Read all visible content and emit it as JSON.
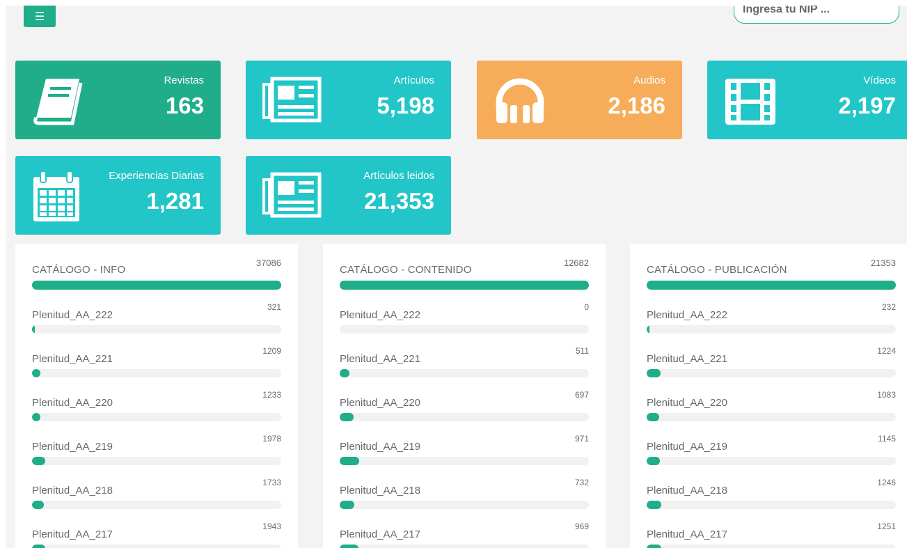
{
  "header": {
    "menu_icon": "menu-icon",
    "search_placeholder": "Ingresa tu NIP ..."
  },
  "colors": {
    "teal": "#23c6c8",
    "green": "#1fad8a",
    "orange": "#f6ac58"
  },
  "stats": [
    {
      "title": "Revistas",
      "value": "163",
      "icon": "magazine-book-icon",
      "color": "green"
    },
    {
      "title": "Artículos",
      "value": "5,198",
      "icon": "newspaper-icon",
      "color": "teal"
    },
    {
      "title": "Audios",
      "value": "2,186",
      "icon": "headphones-icon",
      "color": "orange"
    },
    {
      "title": "Vídeos",
      "value": "2,197",
      "icon": "film-icon",
      "color": "teal"
    },
    {
      "title": "Experiencias Diarias",
      "value": "1,281",
      "icon": "calendar-icon",
      "color": "teal"
    },
    {
      "title": "Artículos leidos",
      "value": "21,353",
      "icon": "newspaper-icon",
      "color": "teal"
    }
  ],
  "panels": [
    {
      "title": "CATÁLOGO - INFO",
      "total": "37086",
      "rows": [
        {
          "label": "Plenitud_AA_222",
          "value": "321",
          "fill": 0.009
        },
        {
          "label": "Plenitud_AA_221",
          "value": "1209",
          "fill": 0.033
        },
        {
          "label": "Plenitud_AA_220",
          "value": "1233",
          "fill": 0.033
        },
        {
          "label": "Plenitud_AA_219",
          "value": "1978",
          "fill": 0.053
        },
        {
          "label": "Plenitud_AA_218",
          "value": "1733",
          "fill": 0.047
        },
        {
          "label": "Plenitud_AA_217",
          "value": "1943",
          "fill": 0.052
        }
      ]
    },
    {
      "title": "CATÁLOGO - CONTENIDO",
      "total": "12682",
      "rows": [
        {
          "label": "Plenitud_AA_222",
          "value": "0",
          "fill": 0
        },
        {
          "label": "Plenitud_AA_221",
          "value": "511",
          "fill": 0.04
        },
        {
          "label": "Plenitud_AA_220",
          "value": "697",
          "fill": 0.055
        },
        {
          "label": "Plenitud_AA_219",
          "value": "971",
          "fill": 0.077
        },
        {
          "label": "Plenitud_AA_218",
          "value": "732",
          "fill": 0.058
        },
        {
          "label": "Plenitud_AA_217",
          "value": "969",
          "fill": 0.076
        }
      ]
    },
    {
      "title": "CATÁLOGO - PUBLICACIÓN",
      "total": "21353",
      "rows": [
        {
          "label": "Plenitud_AA_222",
          "value": "232",
          "fill": 0.011
        },
        {
          "label": "Plenitud_AA_221",
          "value": "1224",
          "fill": 0.057
        },
        {
          "label": "Plenitud_AA_220",
          "value": "1083",
          "fill": 0.051
        },
        {
          "label": "Plenitud_AA_219",
          "value": "1145",
          "fill": 0.054
        },
        {
          "label": "Plenitud_AA_218",
          "value": "1246",
          "fill": 0.058
        },
        {
          "label": "Plenitud_AA_217",
          "value": "1251",
          "fill": 0.059
        }
      ]
    }
  ]
}
